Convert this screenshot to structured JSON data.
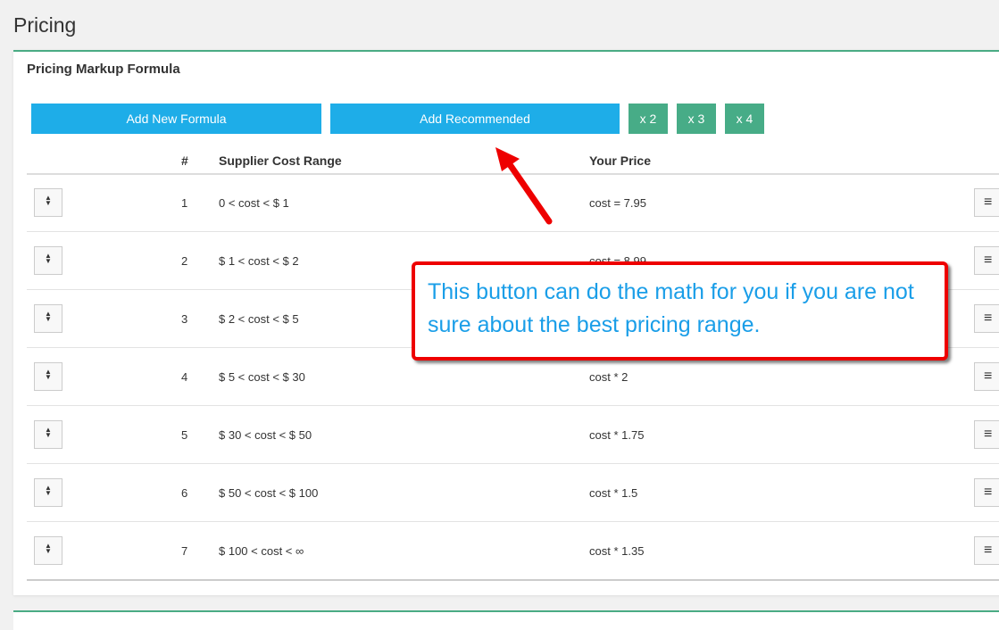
{
  "page": {
    "title": "Pricing"
  },
  "panel": {
    "title": "Pricing Markup Formula",
    "buttons": {
      "add_new": "Add New Formula",
      "add_recommended": "Add Recommended",
      "x2": "x 2",
      "x3": "x 3",
      "x4": "x 4"
    },
    "columns": {
      "num": "#",
      "range": "Supplier Cost Range",
      "price": "Your Price"
    },
    "rows": [
      {
        "num": "1",
        "range": "0 < cost < $ 1",
        "price": "cost = 7.95"
      },
      {
        "num": "2",
        "range": "$ 1 < cost < $ 2",
        "price": "cost = 8.99"
      },
      {
        "num": "3",
        "range": "$ 2 < cost < $ 5",
        "price": ""
      },
      {
        "num": "4",
        "range": "$ 5 < cost < $ 30",
        "price": "cost * 2"
      },
      {
        "num": "5",
        "range": "$ 30 < cost < $ 50",
        "price": "cost * 1.75"
      },
      {
        "num": "6",
        "range": "$ 50 < cost < $ 100",
        "price": "cost * 1.5"
      },
      {
        "num": "7",
        "range": "$ 100 < cost < ∞",
        "price": "cost * 1.35"
      }
    ]
  },
  "annotation": {
    "text": "This button can do the math for you if you are not sure about the best pricing range.",
    "color": "#1a9ee8",
    "border_color": "#ee0000"
  },
  "icons": {
    "drag": "sort-icon",
    "menu": "hamburger-menu-icon"
  }
}
